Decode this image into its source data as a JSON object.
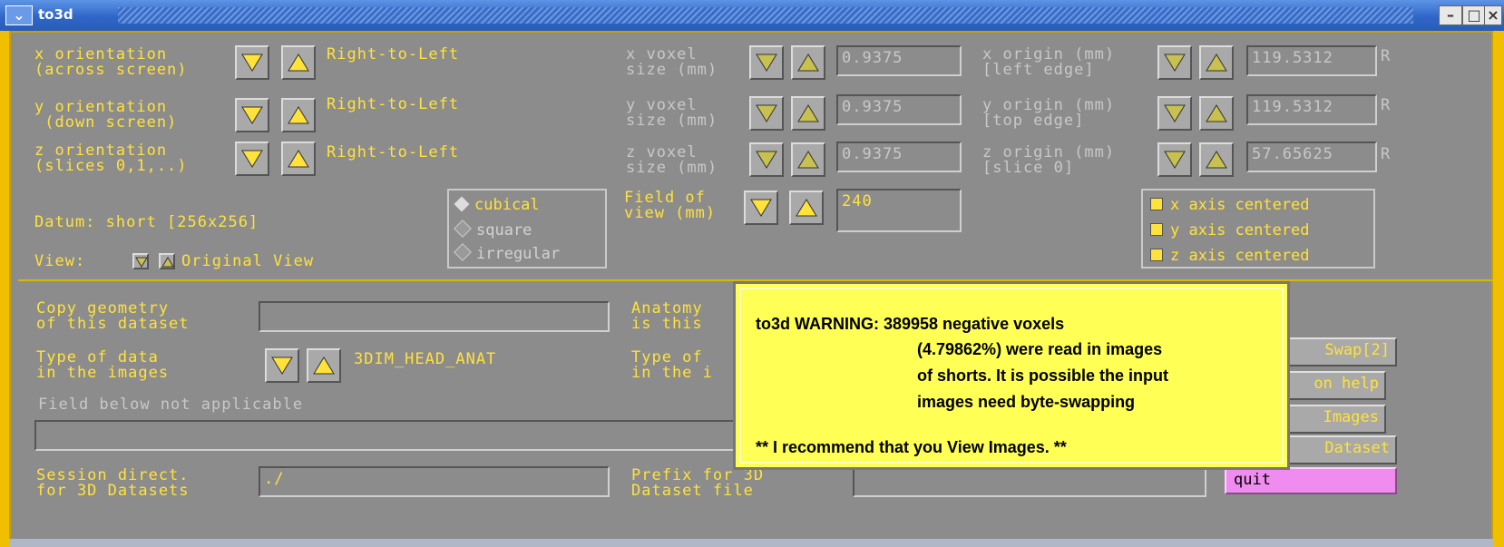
{
  "window": {
    "title": "to3d",
    "menu_icon": "chevron-down-icon"
  },
  "orientation": {
    "x": {
      "label": "x orientation\n(across screen)",
      "value": "Right-to-Left"
    },
    "y": {
      "label": "y orientation\n (down screen)",
      "value": "Right-to-Left"
    },
    "z": {
      "label": "z orientation\n(slices 0,1,..)",
      "value": "Right-to-Left"
    }
  },
  "voxel": {
    "x": {
      "label": "x voxel\nsize (mm)",
      "value": "0.9375"
    },
    "y": {
      "label": "y voxel\nsize (mm)",
      "value": "0.9375"
    },
    "z": {
      "label": "z voxel\nsize (mm)",
      "value": "0.9375"
    }
  },
  "origin": {
    "x": {
      "label": "x origin (mm)\n[left edge]",
      "value": "119.5312",
      "dir": "R"
    },
    "y": {
      "label": "y origin (mm)\n[top edge]",
      "value": "119.5312",
      "dir": "R"
    },
    "z": {
      "label": "z origin (mm)\n[slice 0]",
      "value": "57.65625",
      "dir": "R"
    }
  },
  "datum": "Datum: short [256x256]",
  "view": {
    "label": "View:",
    "value": "Original View"
  },
  "voxel_shape": [
    "cubical",
    "square",
    "irregular"
  ],
  "fov": {
    "label": "Field of\nview (mm)",
    "value": "240"
  },
  "centering": [
    "x axis centered",
    "y axis centered",
    "z axis centered"
  ],
  "copy_geometry": {
    "label": "Copy geometry\nof this dataset",
    "value": ""
  },
  "anatomy": {
    "label": "Anatomy\nis this"
  },
  "type_data": {
    "label": "Type of data\nin the images",
    "value": "3DIM_HEAD_ANAT"
  },
  "type_func": {
    "label": "Type of\nin the i"
  },
  "field_note": "Field below not applicable",
  "session": {
    "label": "Session direct.\nfor 3D Datasets",
    "value": "./"
  },
  "prefix": {
    "label": "Prefix for 3D\nDataset file",
    "value": ""
  },
  "right_buttons": [
    "Swap[2]",
    "on help",
    "Images",
    "Dataset"
  ],
  "quit_label": "quit",
  "warning": {
    "line1": "to3d WARNING: 389958 negative voxels",
    "line2": "(4.79862%) were read in images",
    "line3": "of shorts.  It is possible the input",
    "line4": "images need   byte-swapping",
    "line5": "** I recommend that you View Images. **"
  }
}
